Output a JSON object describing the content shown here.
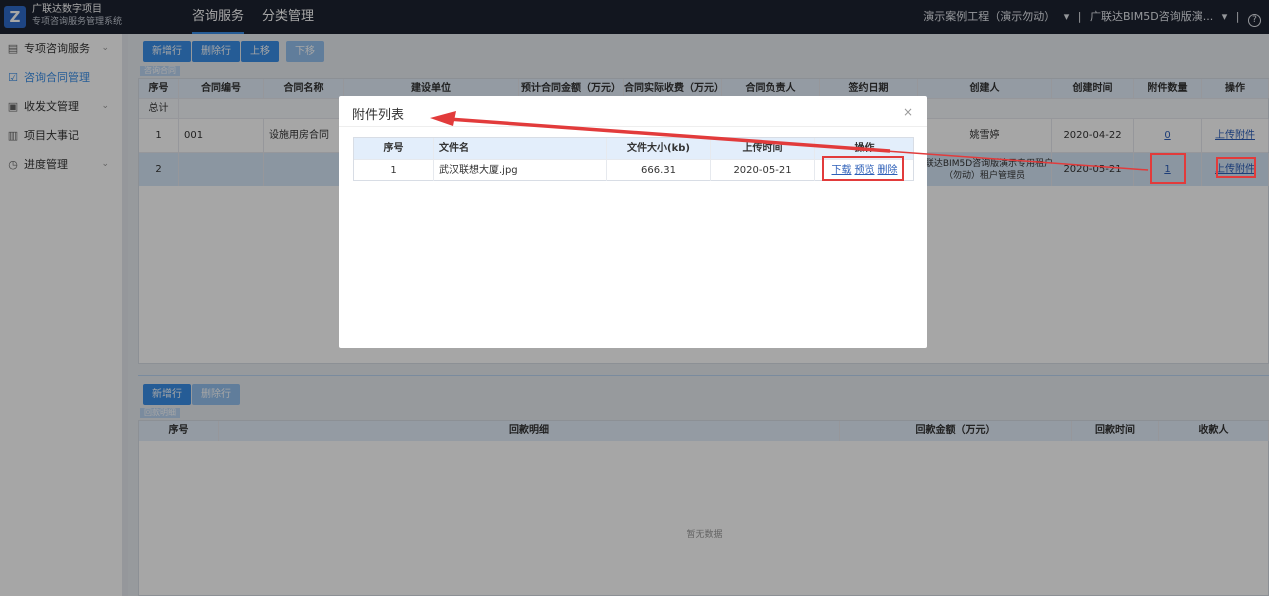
{
  "header": {
    "logo_letter": "Z",
    "brand_line1": "广联达数字项目",
    "brand_line2": "专项咨询服务管理系统",
    "nav_tabs": [
      {
        "label": "咨询服务"
      },
      {
        "label": "分类管理"
      }
    ],
    "project_selector": "演示案例工程（演示勿动）",
    "account_selector": "广联达BIM5D咨询版演...",
    "help_symbol": "?"
  },
  "sidebar": {
    "items": [
      {
        "label": "专项咨询服务"
      },
      {
        "label": "咨询合同管理"
      },
      {
        "label": "收发文管理"
      },
      {
        "label": "项目大事记"
      },
      {
        "label": "进度管理"
      }
    ]
  },
  "toolbar_top": {
    "new_row": "新增行",
    "delete_row": "删除行",
    "move_up": "上移",
    "move_down": "下移"
  },
  "contract_table": {
    "mini_tab": "咨询合同",
    "headers": [
      "序号",
      "合同编号",
      "合同名称",
      "建设单位",
      "预计合同金额（万元）",
      "合同实际收费（万元）",
      "合同负责人",
      "签约日期",
      "创建人",
      "创建时间",
      "附件数量",
      "操作"
    ],
    "total_label": "总计",
    "rows": [
      {
        "index": "1",
        "code": "001",
        "name": "设施用房合同",
        "creator": "姚雪婷",
        "created": "2020-04-22",
        "attachments": "0",
        "action": "上传附件"
      },
      {
        "index": "2",
        "code": "",
        "name": "",
        "creator_line1": "广联达BIM5D咨询版演示专用租户",
        "creator_line2": "（勿动）租户管理员",
        "created": "2020-05-21",
        "attachments": "1",
        "action": "上传附件"
      }
    ]
  },
  "toolbar_bottom": {
    "new_row": "新增行",
    "delete_row": "删除行"
  },
  "payment_table": {
    "mini_tab": "回款明细",
    "headers": [
      "序号",
      "回款明细",
      "回款金额（万元）",
      "回款时间",
      "收款人"
    ],
    "empty_text": "暂无数据"
  },
  "modal": {
    "title": "附件列表",
    "close_symbol": "×",
    "headers": [
      "序号",
      "文件名",
      "文件大小(kb)",
      "上传时间",
      "操作"
    ],
    "rows": [
      {
        "index": "1",
        "file_name": "武汉联想大厦.jpg",
        "size": "666.31",
        "uploaded": "2020-05-21",
        "download": "下载",
        "preview": "预览",
        "delete": "删除"
      }
    ]
  },
  "colors": {
    "accent": "#3a8ee6",
    "topbar": "#1d2330",
    "annotation": "#e23b3b"
  }
}
